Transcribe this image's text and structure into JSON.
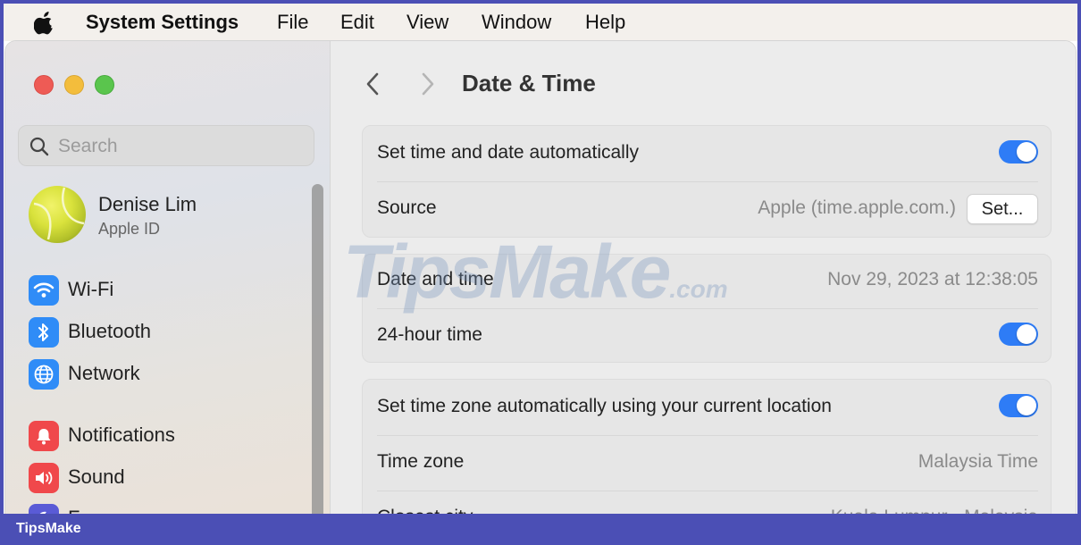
{
  "menubar": {
    "apple_icon": "apple-logo-icon",
    "app_name": "System Settings",
    "items": [
      "File",
      "Edit",
      "View",
      "Window",
      "Help"
    ]
  },
  "sidebar": {
    "search_placeholder": "Search",
    "account": {
      "name": "Denise Lim",
      "subtitle": "Apple ID"
    },
    "items": [
      {
        "label": "Wi-Fi",
        "icon": "wifi-icon",
        "color": "#2f8cf7"
      },
      {
        "label": "Bluetooth",
        "icon": "bluetooth-icon",
        "color": "#2f8cf7"
      },
      {
        "label": "Network",
        "icon": "globe-icon",
        "color": "#2f8cf7"
      },
      {
        "label": "Notifications",
        "icon": "bell-icon",
        "color": "#f0484b"
      },
      {
        "label": "Sound",
        "icon": "speaker-icon",
        "color": "#f0484b"
      },
      {
        "label": "F...",
        "icon": "moon-icon",
        "color": "#5a5bd6"
      }
    ]
  },
  "content": {
    "title": "Date & Time",
    "groups": [
      {
        "rows": [
          {
            "label": "Set time and date automatically",
            "toggle": true
          },
          {
            "label": "Source",
            "value": "Apple (time.apple.com.)",
            "button": "Set..."
          }
        ]
      },
      {
        "rows": [
          {
            "label": "Date and time",
            "value": "Nov 29, 2023 at 12:38:05"
          },
          {
            "label": "24-hour time",
            "toggle": true
          }
        ]
      },
      {
        "rows": [
          {
            "label": "Set time zone automatically using your current location",
            "toggle": true
          },
          {
            "label": "Time zone",
            "value": "Malaysia Time"
          },
          {
            "label": "Closest city",
            "value": "Kuala Lumpur - Malaysia"
          }
        ]
      }
    ]
  },
  "watermark": {
    "text": "TipsMake",
    "suffix": ".com"
  },
  "footer": {
    "brand": "TipsMake"
  },
  "colors": {
    "accent": "#2e7cf6",
    "brand_bar": "#4b4fb5"
  }
}
